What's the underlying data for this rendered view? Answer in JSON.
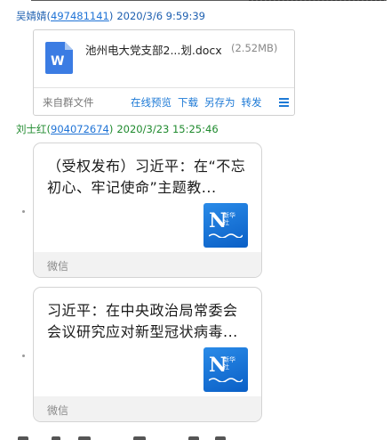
{
  "messages": [
    {
      "sender_name": "吴婧婧",
      "sender_id": "497481141",
      "timestamp": "2020/3/6 9:59:39",
      "file": {
        "icon": "word-document-icon",
        "name": "池州电大党支部2...划.docx",
        "size": "(2.52MB)",
        "source": "来自群文件",
        "actions": [
          "在线预览",
          "下载",
          "另存为",
          "转发"
        ]
      }
    },
    {
      "sender_name": "刘士红",
      "sender_id": "904072674",
      "timestamp": "2020/3/23 15:25:46",
      "shares": [
        {
          "title": "（受权发布）习近平：在“不忘初心、牢记使命”主题教...",
          "source": "微信",
          "thumb_icon": "news-logo-icon",
          "thumb_text": "N",
          "thumb_small": "新华\n社"
        },
        {
          "title": "习近平：在中央政治局常委会会议研究应对新型冠状病毒...",
          "source": "微信",
          "thumb_icon": "news-logo-icon",
          "thumb_text": "N",
          "thumb_small": "新华\n社"
        }
      ]
    }
  ],
  "colors": {
    "sender_1": "#1d5fb0",
    "sender_2": "#1f8a2e",
    "link": "#1e7ad6",
    "card_border": "#d4d4d4"
  }
}
